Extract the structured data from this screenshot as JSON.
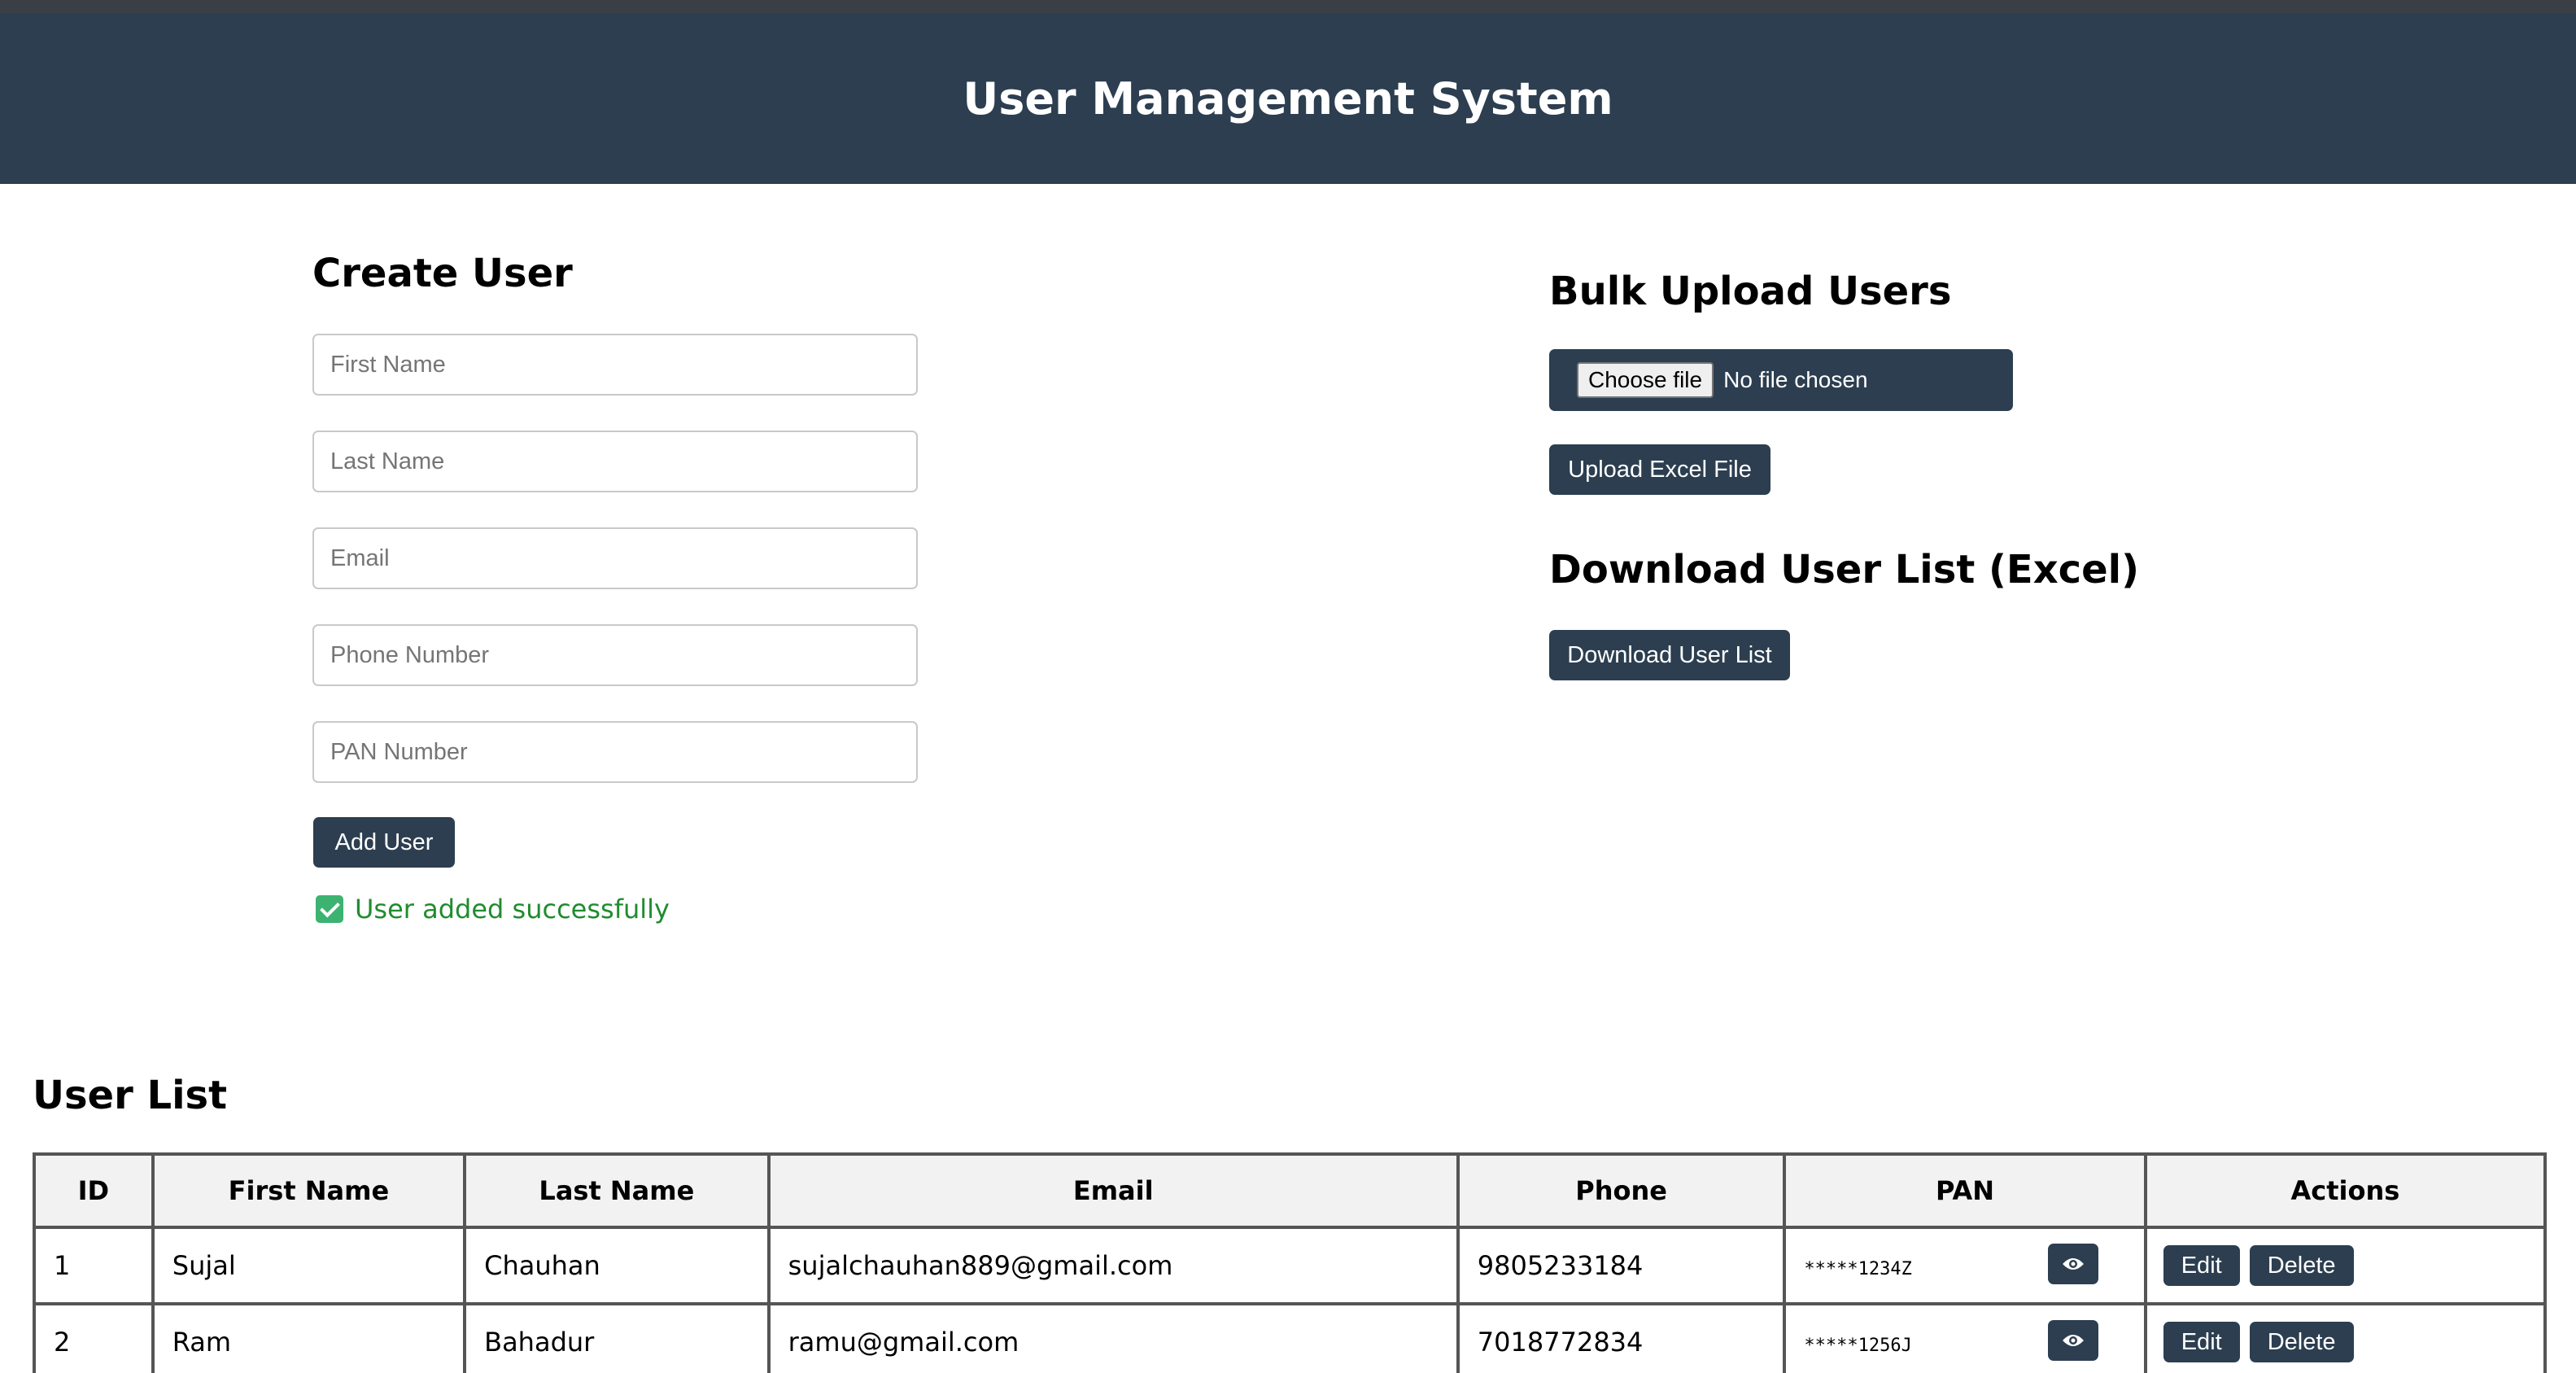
{
  "app": {
    "title": "User Management System"
  },
  "create_user": {
    "heading": "Create User",
    "fields": {
      "first_name": {
        "placeholder": "First Name",
        "value": ""
      },
      "last_name": {
        "placeholder": "Last Name",
        "value": ""
      },
      "email": {
        "placeholder": "Email",
        "value": ""
      },
      "phone": {
        "placeholder": "Phone Number",
        "value": ""
      },
      "pan": {
        "placeholder": "PAN Number",
        "value": ""
      }
    },
    "add_label": "Add User",
    "status_message": "User added successfully"
  },
  "bulk_upload": {
    "heading": "Bulk Upload Users",
    "choose_label": "Choose file",
    "file_status": "No file chosen",
    "upload_label": "Upload Excel File"
  },
  "download": {
    "heading": "Download User List (Excel)",
    "button_label": "Download User List"
  },
  "user_list": {
    "heading": "User List",
    "columns": [
      "ID",
      "First Name",
      "Last Name",
      "Email",
      "Phone",
      "PAN",
      "Actions"
    ],
    "rows": [
      {
        "id": "1",
        "first_name": "Sujal",
        "last_name": "Chauhan",
        "email": "sujalchauhan889@gmail.com",
        "phone": "9805233184",
        "pan": "*****1234Z"
      },
      {
        "id": "2",
        "first_name": "Ram",
        "last_name": "Bahadur",
        "email": "ramu@gmail.com",
        "phone": "7018772834",
        "pan": "*****1256J"
      }
    ],
    "edit_label": "Edit",
    "delete_label": "Delete"
  },
  "colors": {
    "header_bg": "#2c3e50",
    "button_bg": "#2c3e50",
    "success": "#1f8c2e",
    "check": "#3cb371"
  },
  "icons": {
    "status": "checkmark-icon",
    "pan_toggle": "eye-icon"
  }
}
